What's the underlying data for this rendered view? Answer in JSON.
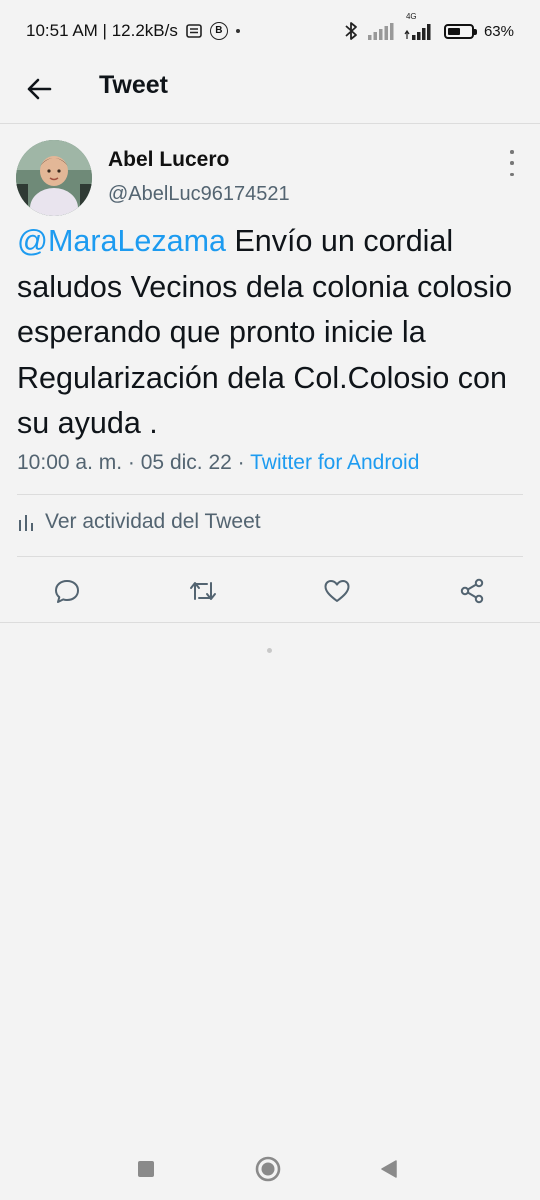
{
  "status_bar": {
    "time_and_speed": "10:51 AM | 12.2kB/s",
    "network_label": "4G",
    "battery_level": 0.63,
    "battery_text": "63%"
  },
  "header": {
    "title": "Tweet"
  },
  "tweet": {
    "author_name": "Abel Lucero",
    "author_handle": "@AbelLuc96174521",
    "mention": "@MaraLezama",
    "body": "Envío un cordial saludos Vecinos dela colonia colosio esperando que pronto inicie la Regularización dela Col.Colosio con su ayuda .",
    "time": "10:00 a. m.",
    "separator": "·",
    "date": "05 dic. 22",
    "source": "Twitter for Android",
    "activity_label": "Ver actividad del Tweet"
  },
  "actions": [
    "reply-icon",
    "retweet-icon",
    "like-icon",
    "share-icon"
  ],
  "colors": {
    "accent": "#1d9bf0",
    "secondary_text": "#536471",
    "background": "#f3f3f3"
  }
}
